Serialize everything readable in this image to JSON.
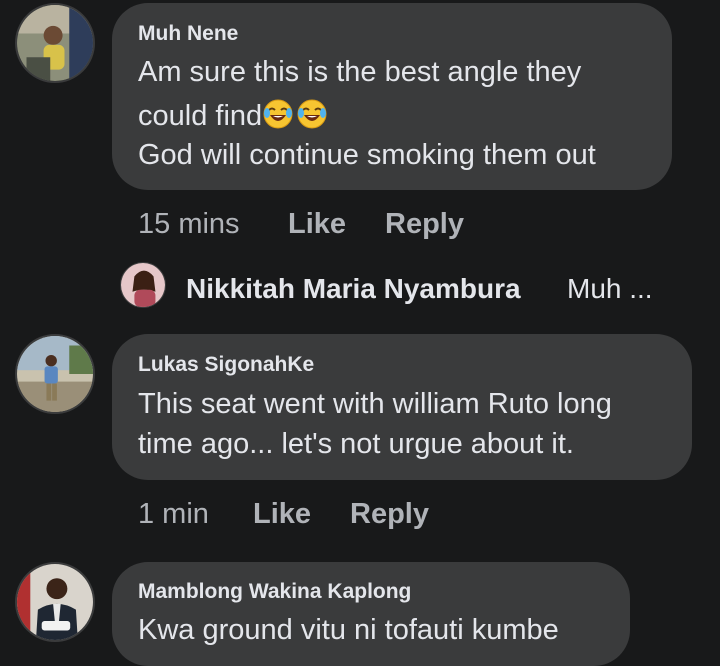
{
  "comments": [
    {
      "author": "Muh Nene",
      "lines": [
        "Am sure this is the best angle they",
        "could find",
        "God will continue smoking them out"
      ],
      "emoji": [
        "laughing-crying-emoji",
        "laughing-crying-emoji"
      ],
      "time": "15 mins",
      "like_label": "Like",
      "reply_label": "Reply"
    },
    {
      "author": "Lukas SigonahKe",
      "lines": [
        "This seat went with william Ruto long",
        "time ago... let's not urgue about it."
      ],
      "time": "1 min",
      "like_label": "Like",
      "reply_label": "Reply"
    },
    {
      "author": "Mamblong Wakina Kaplong",
      "lines": [
        "Kwa ground vitu ni tofauti kumbe"
      ]
    }
  ],
  "reply_preview": {
    "author": "Nikkitah Maria Nyambura",
    "snippet": "Muh ..."
  },
  "colors": {
    "background": "#18191a",
    "bubble": "#3a3b3c",
    "text_primary": "#e4e6eb",
    "text_secondary": "#b0b3b8"
  }
}
